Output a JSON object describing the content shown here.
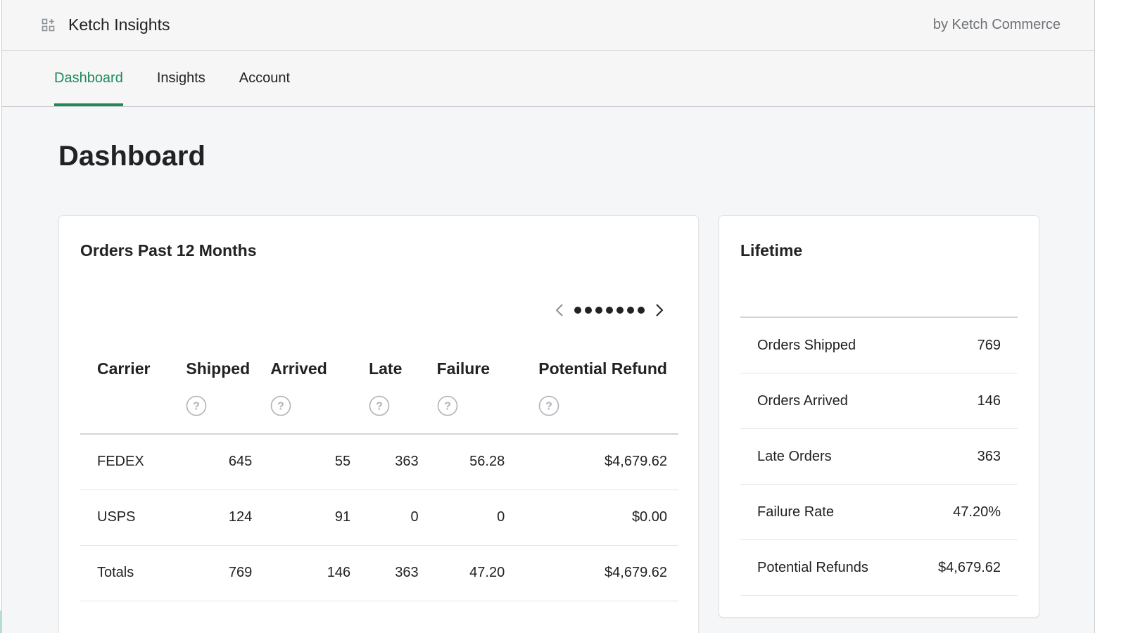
{
  "app": {
    "title": "Ketch Insights",
    "byline": "by Ketch Commerce",
    "icon": "apps-grid-icon"
  },
  "nav": {
    "tabs": [
      {
        "label": "Dashboard",
        "active": true
      },
      {
        "label": "Insights",
        "active": false
      },
      {
        "label": "Account",
        "active": false
      }
    ]
  },
  "page": {
    "title": "Dashboard"
  },
  "orders_card": {
    "title": "Orders Past 12 Months",
    "pager": {
      "dot_count": 7
    },
    "columns": [
      "Carrier",
      "Shipped",
      "Arrived",
      "Late",
      "Failure",
      "Potential Refund"
    ],
    "rows": [
      {
        "carrier": "FEDEX",
        "shipped": "645",
        "arrived": "55",
        "late": "363",
        "failure": "56.28",
        "refund": "$4,679.62"
      },
      {
        "carrier": "USPS",
        "shipped": "124",
        "arrived": "91",
        "late": "0",
        "failure": "0",
        "refund": "$0.00"
      },
      {
        "carrier": "Totals",
        "shipped": "769",
        "arrived": "146",
        "late": "363",
        "failure": "47.20",
        "refund": "$4,679.62"
      }
    ]
  },
  "lifetime_card": {
    "title": "Lifetime",
    "stats": [
      {
        "label": "Orders Shipped",
        "value": "769"
      },
      {
        "label": "Orders Arrived",
        "value": "146"
      },
      {
        "label": "Late Orders",
        "value": "363"
      },
      {
        "label": "Failure Rate",
        "value": "47.20%"
      },
      {
        "label": "Potential Refunds",
        "value": "$4,679.62"
      }
    ]
  },
  "colors": {
    "accent": "#1e8a5a",
    "background": "#f4f6f8",
    "text": "#202223"
  }
}
